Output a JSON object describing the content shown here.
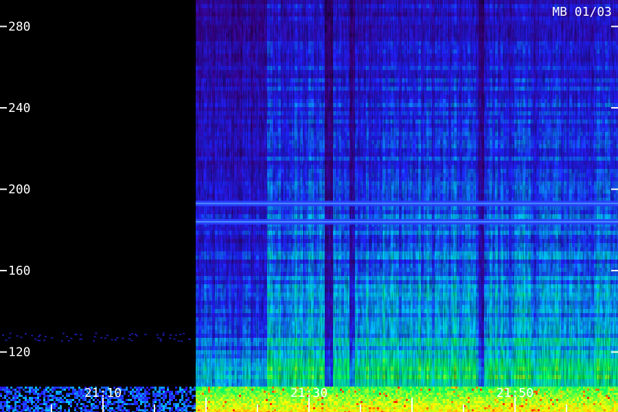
{
  "chart_data": {
    "type": "heatmap",
    "title": "MB 01/03",
    "xlabel": "",
    "ylabel": "",
    "y_ticks": [
      120,
      160,
      200,
      240,
      280
    ],
    "ylim": [
      103,
      293
    ],
    "x_ticks": [
      "21:10",
      "21:30",
      "21:50"
    ],
    "xlim": [
      "21:00",
      "22:00"
    ],
    "grid": false,
    "colormap": [
      "#000000",
      "#3a0088",
      "#2020ff",
      "#00c8ff",
      "#00ff60",
      "#ffff00",
      "#ff2000"
    ],
    "data_start": "21:19",
    "bands": [
      {
        "center": 193,
        "intensity": "high"
      },
      {
        "center": 184,
        "intensity": "high"
      }
    ]
  },
  "colors": {
    "background": "#000000",
    "text": "#ffffff"
  }
}
